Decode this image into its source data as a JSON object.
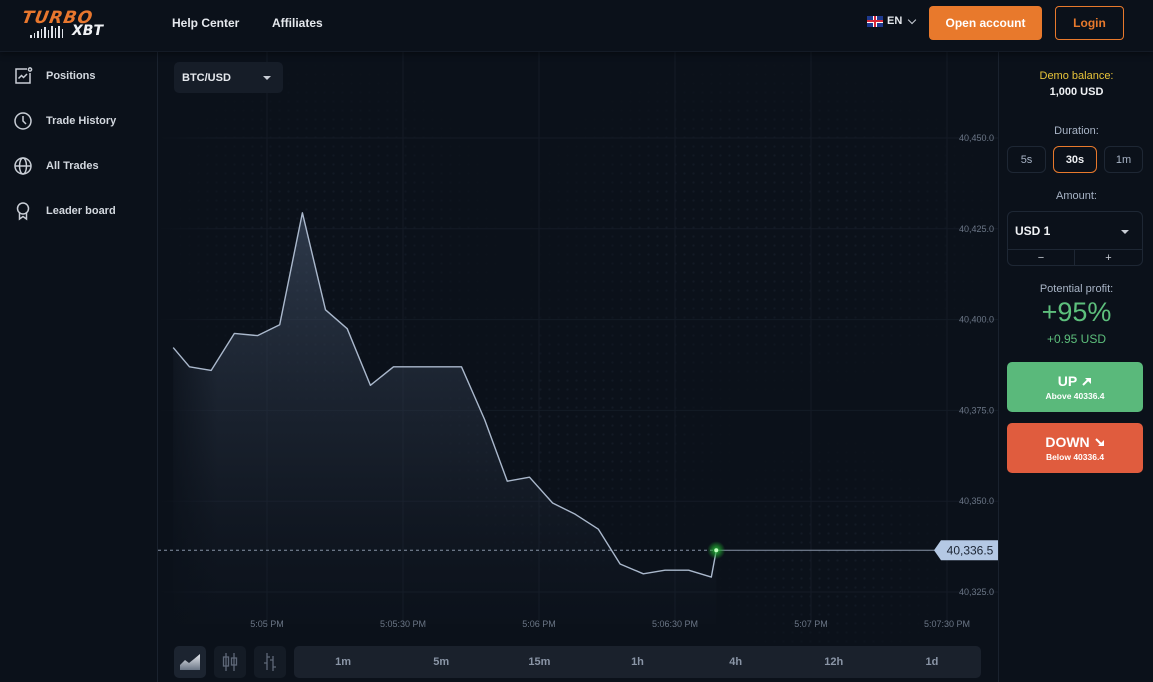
{
  "header": {
    "logo_top": "TURBO",
    "logo_bottom": "XBT",
    "nav": [
      "Help Center",
      "Affiliates"
    ],
    "language": "EN",
    "open_account": "Open account",
    "login": "Login"
  },
  "sidebar": {
    "items": [
      {
        "label": "Positions",
        "icon": "chart-frame-icon"
      },
      {
        "label": "Trade History",
        "icon": "clock-icon"
      },
      {
        "label": "All Trades",
        "icon": "globe-icon"
      },
      {
        "label": "Leader board",
        "icon": "award-ribbon-icon"
      }
    ]
  },
  "chart": {
    "pair": "BTC/USD",
    "current_price_label": "40,336.5",
    "chart_types": [
      "area",
      "candles",
      "bars"
    ],
    "active_chart_type": "area",
    "timeframes": [
      "1m",
      "5m",
      "15m",
      "1h",
      "4h",
      "12h",
      "1d"
    ]
  },
  "chart_data": {
    "type": "area",
    "title": "BTC/USD",
    "xlabel": "",
    "ylabel": "",
    "y_ticks": [
      40450.0,
      40425.0,
      40400.0,
      40375.0,
      40350.0,
      40325.0
    ],
    "y_tick_labels": [
      "40,450.0",
      "40,425.0",
      "40,400.0",
      "40,375.0",
      "40,350.0",
      "40,325.0"
    ],
    "x_ticks_seconds": [
      300,
      330,
      360,
      390,
      420,
      450
    ],
    "x_tick_labels": [
      "5:05 PM",
      "5:05:30 PM",
      "5:06 PM",
      "5:06:30 PM",
      "5:07 PM",
      "5:07:30 PM"
    ],
    "x_reference": "5:00 PM + seconds",
    "ylim": [
      40322.5,
      40470.0
    ],
    "xlim": [
      279.3,
      464.6
    ],
    "grid": true,
    "series": [
      {
        "name": "BTC/USD",
        "x_seconds": [
          279.3,
          282.9,
          287.7,
          292.8,
          297.9,
          302.8,
          307.8,
          312.9,
          317.7,
          322.8,
          327.9,
          342.9,
          348.0,
          353.0,
          357.9,
          363.0,
          368.0,
          373.1,
          377.9,
          383.0,
          387.8,
          393.0,
          398.0,
          399.1
        ],
        "values": [
          40392.3,
          40387.0,
          40386.0,
          40396.2,
          40395.6,
          40398.6,
          40429.4,
          40402.7,
          40397.5,
          40381.9,
          40387.0,
          40387.0,
          40372.5,
          40355.5,
          40356.6,
          40349.5,
          40346.4,
          40342.3,
          40332.7,
          40330.0,
          40331.0,
          40331.0,
          40329.1,
          40336.5
        ]
      }
    ],
    "current_price": 40336.5
  },
  "trade_panel": {
    "demo_label": "Demo balance:",
    "demo_value": "1,000 USD",
    "duration_label": "Duration:",
    "durations": [
      "5s",
      "30s",
      "1m"
    ],
    "active_duration": "30s",
    "amount_label": "Amount:",
    "amount_value": "USD 1",
    "minus": "−",
    "plus": "+",
    "profit_label": "Potential profit:",
    "profit_pct": "+95%",
    "profit_usd": "+0.95 USD",
    "up_label": "UP",
    "up_sub": "Above 40336.4",
    "down_label": "DOWN",
    "down_sub": "Below 40336.4",
    "colors": {
      "accent": "#e8792c",
      "up": "#5ab97b",
      "down": "#e05c3e",
      "demo": "#e8c43a"
    }
  }
}
